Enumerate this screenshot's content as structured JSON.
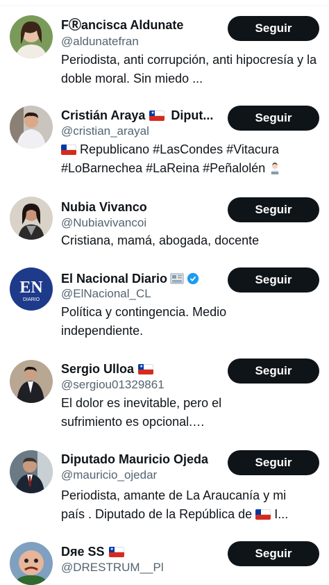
{
  "follow_label": "Seguir",
  "accounts": [
    {
      "name": "FⓇancisca Aldunate",
      "handle": "@aldunatefran",
      "bio": "Periodista, anti corrupción, anti hipocresía y la doble moral. Sin miedo ..."
    },
    {
      "name": "Cristián Araya",
      "name_suffix": "Diput...",
      "handle": "@cristian_arayal",
      "bio_line1": "Republicano #LasCondes #Vitacura",
      "bio_line2": "#LoBarnechea #LaReina #Peñalolén"
    },
    {
      "name": "Nubia Vivanco",
      "handle": "@Nubiavivancoi",
      "bio": "Cristiana, mamá, abogada, docente"
    },
    {
      "name": "El Nacional Diario",
      "handle": "@ElNacional_CL",
      "bio": "Política y contingencia. Medio independiente.",
      "avatar_text": "EN",
      "avatar_subtext": "DIARIO"
    },
    {
      "name": "Sergio Ulloa",
      "handle": "@sergiou01329861",
      "bio": "El dolor es inevitable, pero el sufrimiento es opcional.…"
    },
    {
      "name": "Diputado Mauricio Ojeda",
      "handle": "@mauricio_ojedar",
      "bio_line1": "Periodista, amante de La Araucanía y mi",
      "bio_line2": "país . Diputado de la República de",
      "bio_line2_tail": "I..."
    },
    {
      "name": "Dяe SS",
      "handle": "@DRESTRUM__Pl"
    }
  ],
  "colors": {
    "text": "#0f1419",
    "secondary": "#536471",
    "button_bg": "#0f1419",
    "button_text": "#ffffff",
    "verified": "#1d9bf0",
    "flag_red": "#d52b1e",
    "flag_blue": "#0039a6"
  }
}
